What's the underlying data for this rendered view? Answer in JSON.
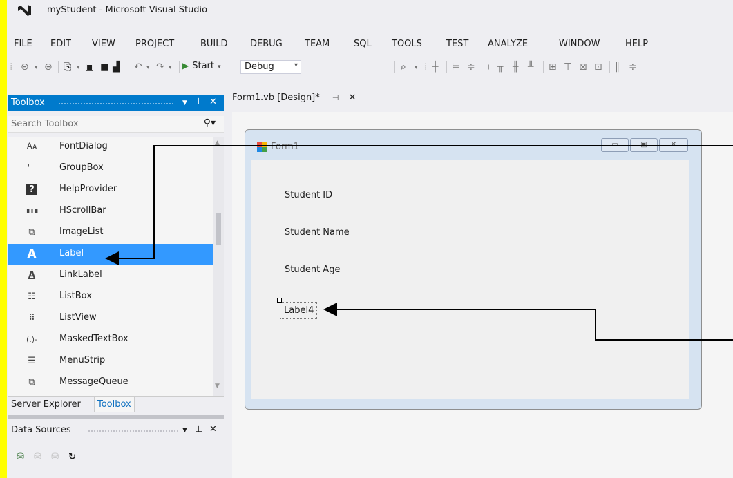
{
  "app": {
    "title": "myStudent - Microsoft Visual Studio"
  },
  "menu": [
    "FILE",
    "EDIT",
    "VIEW",
    "PROJECT",
    "BUILD",
    "DEBUG",
    "TEAM",
    "SQL",
    "TOOLS",
    "TEST",
    "ANALYZE",
    "WINDOW",
    "HELP"
  ],
  "toolbar": {
    "start_label": "Start",
    "config_value": "Debug"
  },
  "toolbox": {
    "title": "Toolbox",
    "search_placeholder": "Search Toolbox",
    "items": [
      "FontDialog",
      "GroupBox",
      "HelpProvider",
      "HScrollBar",
      "ImageList",
      "Label",
      "LinkLabel",
      "ListBox",
      "ListView",
      "MaskedTextBox",
      "MenuStrip",
      "MessageQueue"
    ],
    "selected_index": 5,
    "bottom_tabs": [
      "Server Explorer",
      "Toolbox"
    ]
  },
  "data_sources": {
    "title": "Data Sources"
  },
  "document": {
    "tab_label": "Form1.vb [Design]*"
  },
  "form": {
    "title": "Form1",
    "labels": [
      "Student ID",
      "Student Name",
      "Student Age"
    ],
    "selected_label": "Label4"
  },
  "colors": {
    "accent": "#007acc",
    "selection": "#3399ff",
    "highlight_border": "#ffff00"
  }
}
